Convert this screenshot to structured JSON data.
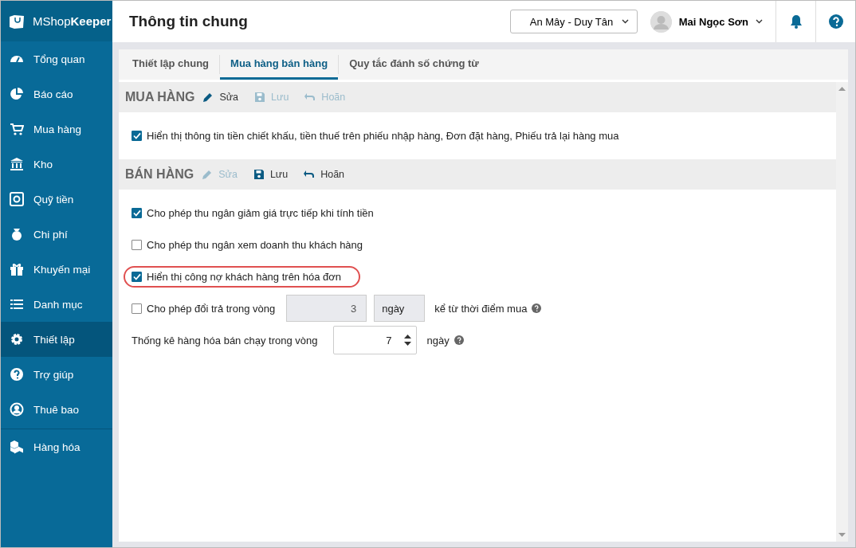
{
  "logo": {
    "text": "MShop**Keeper**"
  },
  "sidebar": {
    "items": [
      {
        "label": "Tổng quan",
        "selected": false
      },
      {
        "label": "Báo cáo",
        "selected": false
      },
      {
        "label": "Mua hàng",
        "selected": false
      },
      {
        "label": "Kho",
        "selected": false
      },
      {
        "label": "Quỹ tiền",
        "selected": false
      },
      {
        "label": "Chi phí",
        "selected": false
      },
      {
        "label": "Khuyến mại",
        "selected": false
      },
      {
        "label": "Danh mục",
        "selected": false
      },
      {
        "label": "Thiết lập",
        "selected": true
      },
      {
        "label": "Trợ giúp",
        "selected": false
      },
      {
        "label": "Thuê bao",
        "selected": false
      }
    ],
    "footer_items": [
      {
        "label": "Hàng hóa",
        "selected": false
      }
    ]
  },
  "header": {
    "title": "Thông tin chung",
    "store_select": {
      "value": "An Mây - Duy Tân"
    },
    "user": {
      "name": "Mai Ngọc Sơn"
    }
  },
  "tabs": [
    {
      "label": "Thiết lập chung",
      "selected": false
    },
    {
      "label": "Mua hàng bán hàng",
      "selected": true
    },
    {
      "label": "Quy tắc đánh số chứng từ",
      "selected": false
    }
  ],
  "sections": [
    {
      "title": "MUA HÀNG",
      "actions": [
        {
          "label": "Sửa",
          "disabled": false
        },
        {
          "label": "Lưu",
          "disabled": true
        },
        {
          "label": "Hoãn",
          "disabled": true
        }
      ],
      "options": [
        {
          "kind": "checkbox",
          "label": "Hiển thị thông tin tiền chiết khấu, tiền thuế trên phiếu nhập hàng, Đơn đặt hàng, Phiếu trả lại hàng mua",
          "checked": true,
          "highlighted": false
        }
      ]
    },
    {
      "title": "BÁN HÀNG",
      "actions": [
        {
          "label": "Sửa",
          "disabled": true
        },
        {
          "label": "Lưu",
          "disabled": false
        },
        {
          "label": "Hoãn",
          "disabled": false
        }
      ],
      "options": [
        {
          "kind": "checkbox",
          "label": "Cho phép thu ngân giảm giá trực tiếp khi tính tiền",
          "checked": true,
          "highlighted": false
        },
        {
          "kind": "checkbox",
          "label": "Cho phép thu ngân xem doanh thu khách hàng",
          "checked": false,
          "highlighted": false
        },
        {
          "kind": "checkbox",
          "label": "Hiển thị công nợ khách hàng trên hóa đơn",
          "checked": true,
          "highlighted": true
        },
        {
          "kind": "period",
          "label": "Cho phép đổi trả trong vòng",
          "checked": false,
          "value": "3",
          "unit": "ngày",
          "suffix": "kể từ thời điểm mua"
        },
        {
          "kind": "stepper",
          "label": "Thống kê hàng hóa bán chạy trong vòng",
          "value": "7",
          "unit": "ngày"
        }
      ]
    }
  ]
}
